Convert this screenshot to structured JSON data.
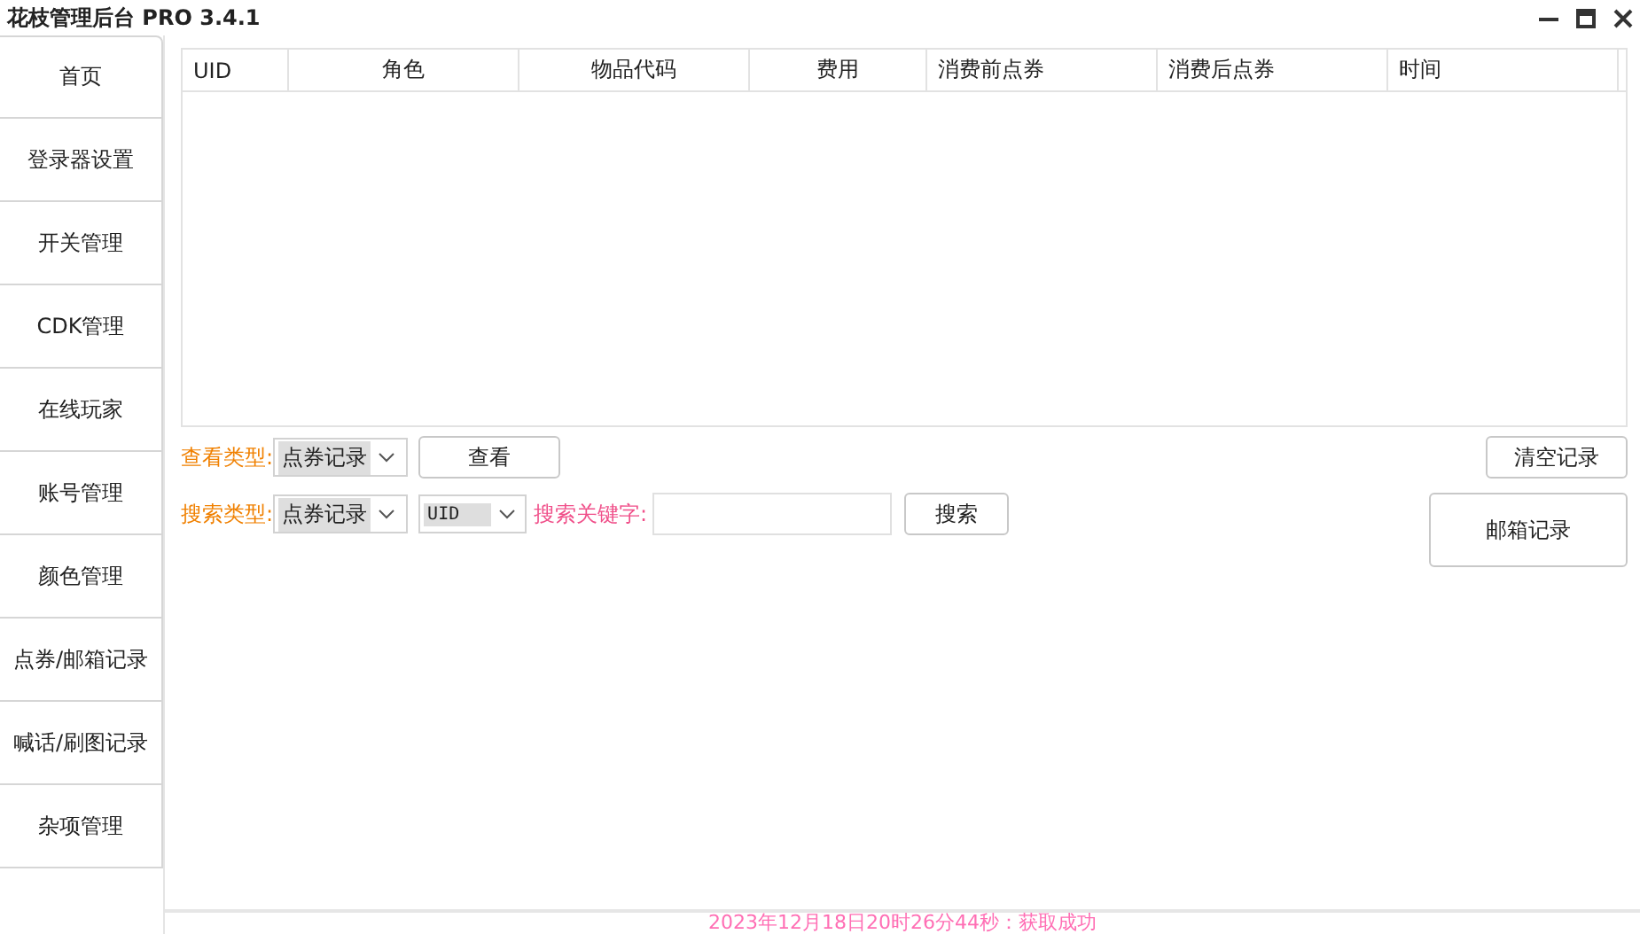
{
  "window": {
    "title": "花枝管理后台 PRO 3.4.1"
  },
  "sidebar": {
    "items": [
      {
        "label": "首页",
        "selected": false
      },
      {
        "label": "登录器设置",
        "selected": false
      },
      {
        "label": "开关管理",
        "selected": false
      },
      {
        "label": "CDK管理",
        "selected": false
      },
      {
        "label": "在线玩家",
        "selected": false
      },
      {
        "label": "账号管理",
        "selected": false
      },
      {
        "label": "颜色管理",
        "selected": false
      },
      {
        "label": "点券/邮箱记录",
        "selected": false
      },
      {
        "label": "喊话/刷图记录",
        "selected": false
      },
      {
        "label": "杂项管理",
        "selected": false
      }
    ]
  },
  "table": {
    "columns": [
      "UID",
      "角色",
      "物品代码",
      "费用",
      "消费前点券",
      "消费后点券",
      "时间"
    ]
  },
  "view_row": {
    "label": "查看类型:",
    "select_value": "点券记录",
    "button": "查看"
  },
  "search_row": {
    "label": "搜索类型:",
    "select_value": "点券记录",
    "field_select_value": "UID",
    "keyword_label": "搜索关键字:",
    "button": "搜索"
  },
  "clear_button": "清空记录",
  "mail_button": "邮箱记录",
  "status_bar": {
    "message": "2023年12月18日20时26分44秒：获取成功"
  }
}
